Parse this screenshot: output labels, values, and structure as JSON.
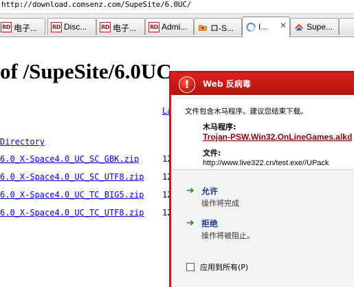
{
  "address_bar": {
    "url": "http://download.comsenz.com/SupeSite/6.0UC/"
  },
  "tabs": [
    {
      "label": "电子...",
      "icon": "rd-icon",
      "icon_text": "RD"
    },
    {
      "label": "Disc...",
      "icon": "rd-icon",
      "icon_text": "RD"
    },
    {
      "label": "电子...",
      "icon": "rd-icon",
      "icon_text": "RD"
    },
    {
      "label": "Admi...",
      "icon": "rd-icon",
      "icon_text": "RD"
    },
    {
      "label": "ロ-S...",
      "icon": "folder-heart-icon"
    },
    {
      "label": "I...",
      "icon": "loading-icon",
      "active": true,
      "close": "✕"
    },
    {
      "label": "Supe...",
      "icon": "supesite-icon"
    }
  ],
  "page": {
    "heading": "of /SupeSite/6.0UC",
    "column_last_modified": "La",
    "parent_directory": "Directory",
    "files": [
      {
        "name": "6.0_X-Space4.0_UC_SC_GBK.zip",
        "date": "12"
      },
      {
        "name": "6.0_X-Space4.0_UC_SC_UTF8.zip",
        "date": "12"
      },
      {
        "name": "6.0_X-Space4.0_UC_TC_BIG5.zip",
        "date": "12"
      },
      {
        "name": "6.0_X-Space4.0_UC_TC_UTF8.zip",
        "date": "12"
      }
    ]
  },
  "popup": {
    "title": "Web 反病毒",
    "icon_glyph": "!",
    "message": "文件包含木马程序。建议您结束下载。",
    "trojan_label": "木马程序:",
    "trojan_name": "Trojan-PSW.Win32.OnLineGames.alkd",
    "file_label": "文件:",
    "file_url": "http://www.live322.cn/test.exe//UPack",
    "actions": [
      {
        "arrow": "➜",
        "title": "允许",
        "desc": "操作将完成"
      },
      {
        "arrow": "➜",
        "title": "拒绝",
        "desc": "操作将被阻止。"
      }
    ],
    "apply_all_label": "应用到所有(P)",
    "apply_all_checked": false
  },
  "colors": {
    "popup_red": "#c21a16",
    "trojan_red": "#8b0000",
    "action_blue": "#1a3d8f",
    "arrow_green": "#1f8a2a",
    "link_blue": "#0000ee"
  }
}
